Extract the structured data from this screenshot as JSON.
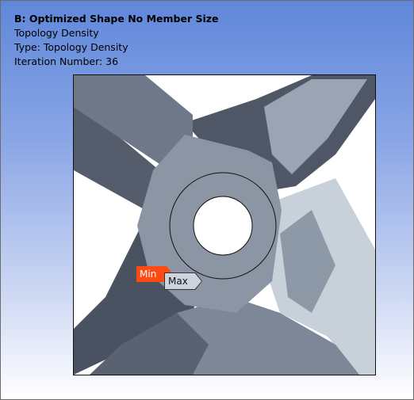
{
  "info": {
    "title": "B: Optimized Shape No Member Size",
    "line1": "Topology Density",
    "line2": "Type: Topology Density",
    "line3": "Iteration Number: 36"
  },
  "probes": {
    "min_label": "Min",
    "max_label": "Max"
  },
  "colors": {
    "min": "#ff4a12",
    "max": "#cdd4de",
    "background_top": "#5f87d9",
    "background_bottom": "#ffffff",
    "part_dark": "#4a5160",
    "part_mid": "#8791a0",
    "part_light": "#cfd6df"
  }
}
